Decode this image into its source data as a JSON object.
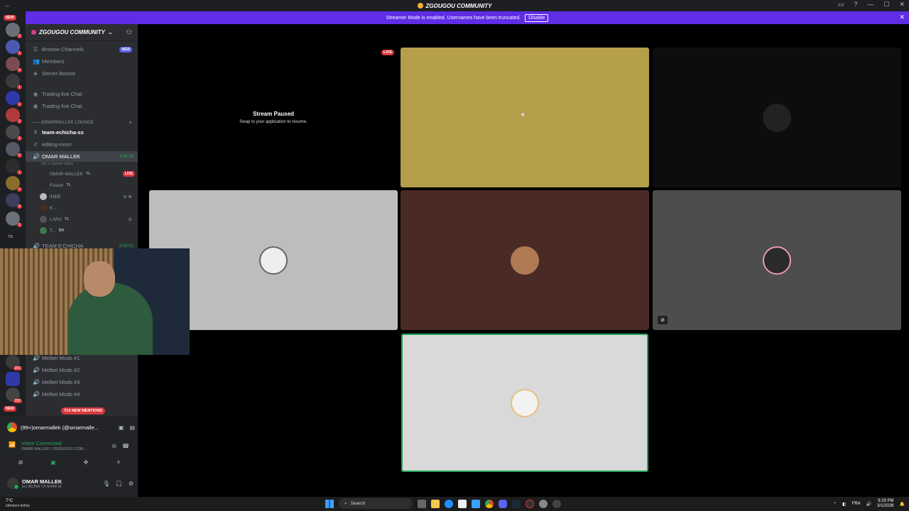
{
  "window": {
    "title": "ZGOUGOU COMMUNITY",
    "back": "←",
    "controls": [
      "▭",
      "?",
      "—",
      "☐",
      "✕"
    ]
  },
  "banner": {
    "text": "Streamer Mode is enabled. Usernames have been truncated.",
    "disable_label": "Disable",
    "close": "✕"
  },
  "rail": {
    "new_label": "NEW",
    "rs_label": "rs",
    "badges": [
      "2",
      "1",
      "2",
      "1",
      "1",
      "2",
      "1",
      "2",
      "1",
      "1",
      "2",
      "1",
      "361",
      "292",
      "NEW"
    ]
  },
  "sidebar": {
    "server_name": "ZGOUGOU COMMUNITY",
    "items": [
      {
        "label": "Browse Channels",
        "icon": "☰",
        "tag": "NEW"
      },
      {
        "label": "Members",
        "icon": "👥"
      },
      {
        "label": "Server Boosts",
        "icon": "◈"
      },
      {
        "label": "Trading live Chat",
        "icon": "◉"
      },
      {
        "label": "Trading live Chat",
        "icon": "◉"
      }
    ],
    "category": "——|OMARMALLEK LOUNGE",
    "text_channels": [
      {
        "label": "team-echicha-ss"
      },
      {
        "label": "editing-room"
      }
    ],
    "voice_channel": {
      "label": "OMAR MALLEK",
      "time": "2:44:36",
      "status": "Set a channel status"
    },
    "voice_users": [
      {
        "name": "OMAR MALLEK",
        "tag": "TL",
        "live": "LIVE"
      },
      {
        "name": "Fusion",
        "tag": "TL"
      },
      {
        "name": "IHEB",
        "tag": ""
      },
      {
        "name": "K...",
        "tag": ""
      },
      {
        "name": "LARA",
        "tag": "TL"
      },
      {
        "name": "T...",
        "tag": "BR"
      }
    ],
    "voice_channel_2": {
      "label": "TEAM E'CHICHA",
      "time": "8:00:52"
    },
    "mods": [
      "Melbet Mods #1",
      "Melbet Mods #2",
      "Melbet Mods #3",
      "Melbet Mods #4"
    ],
    "mentions": "714 NEW MENTIONS"
  },
  "panel": {
    "user_label": "(99+)omarmallek (@omarmalle...",
    "voice_status": "Voice Connected",
    "voice_channel": "OMAR MALLEK / ZGOUGOU COM...",
    "me_name": "OMAR MALLEK",
    "me_status": "ELI BE3NA YJI NHAR W"
  },
  "stage": {
    "paused_title": "Stream Paused",
    "paused_sub": "Swap to your application to resume.",
    "live_label": "LIVE",
    "tile_colors": [
      "#b59f4b",
      "#0d0d0d",
      "#bdbdbd",
      "#4a2a24",
      "#4d4d4d",
      "#d9d9d9"
    ]
  },
  "taskbar": {
    "temp": "7°C",
    "weather": "Időnként felhős",
    "search_placeholder": "Search",
    "lang": "FRA",
    "time": "9:29 PM",
    "date": "3/1/2026"
  }
}
